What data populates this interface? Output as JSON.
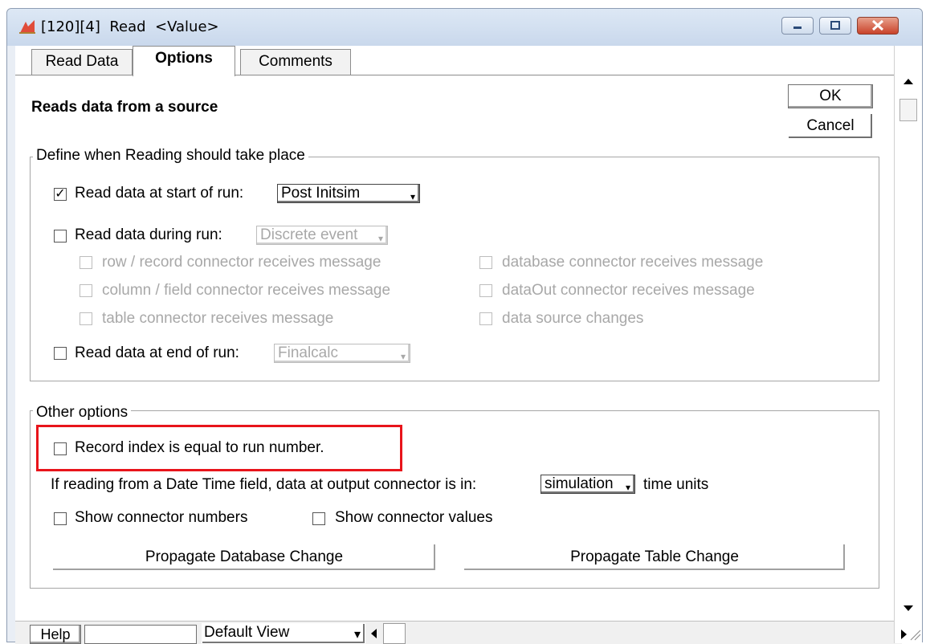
{
  "window": {
    "title": "[120][4]  Read  <Value>",
    "colors": {
      "accent_red": "#e8141b",
      "titlebar": "#c9d8ec",
      "close": "#c9432a"
    }
  },
  "tabs": [
    {
      "label": "Read Data"
    },
    {
      "label": "Options",
      "active": true
    },
    {
      "label": "Comments"
    }
  ],
  "header": {
    "description": "Reads data from a source",
    "ok_label": "OK",
    "cancel_label": "Cancel"
  },
  "reading_group": {
    "legend": "Define when Reading should take place",
    "start_run": {
      "label": "Read data at start of run:",
      "checked": true,
      "value": "Post Initsim"
    },
    "during_run": {
      "label": "Read data during run:",
      "checked": false,
      "value": "Discrete event"
    },
    "during_options": [
      {
        "label": "row / record connector receives message"
      },
      {
        "label": "column / field connector receives message"
      },
      {
        "label": "table connector receives message"
      },
      {
        "label": "database connector receives message"
      },
      {
        "label": "dataOut connector receives message"
      },
      {
        "label": "data source changes"
      }
    ],
    "end_run": {
      "label": "Read data at end of run:",
      "checked": false,
      "value": "Finalcalc"
    }
  },
  "other_group": {
    "legend": "Other options",
    "record_index": {
      "label": "Record index is equal to run number.",
      "checked": false
    },
    "datetime_prefix": "If reading from a Date Time field, data at output connector is in:",
    "datetime_value": "simulation",
    "datetime_suffix": "time units",
    "show_numbers": {
      "label": "Show connector numbers",
      "checked": false
    },
    "show_values": {
      "label": "Show connector values",
      "checked": false
    },
    "propagate_db": "Propagate Database Change",
    "propagate_table": "Propagate Table Change"
  },
  "statusbar": {
    "help_label": "Help",
    "view_value": "Default View"
  },
  "icons": {
    "check": "✓",
    "dropdown": "▾"
  }
}
